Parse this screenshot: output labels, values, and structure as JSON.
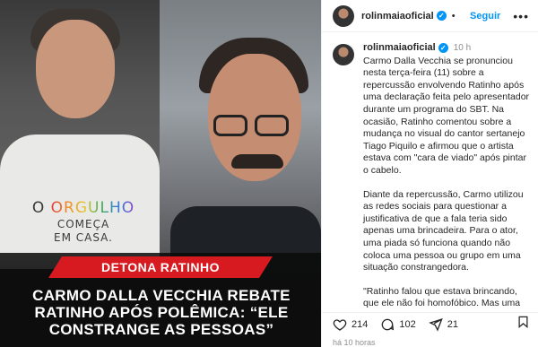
{
  "post": {
    "author": "rolinmaiaoficial",
    "follow_label": "Seguir",
    "more_label": "•••",
    "dot": "•",
    "verified_mark": "✓",
    "time_ago": "10 h",
    "caption_paragraphs": [
      "Carmo Dalla Vecchia se pronunciou nesta terça-feira (11) sobre a repercussão envolvendo Ratinho após uma declaração feita pelo apresentador durante um programa do SBT. Na ocasião, Ratinho comentou sobre a mudança no visual do cantor sertanejo Tiago Piquilo e afirmou que o artista estava com \"cara de viado\" após pintar o cabelo.",
      "Diante da repercussão, Carmo utilizou as redes sociais para questionar a justificativa de que a fala teria sido apenas uma brincadeira. Para o ator, uma piada só funciona quando não coloca uma pessoa ou grupo em uma situação constrangedora.",
      "\"Ratinho falou que estava brincando, que ele não foi homofóbico. Mas uma"
    ],
    "likes": "214",
    "comments": "102",
    "shares": "21",
    "posted_ago": "há 10 horas"
  },
  "image": {
    "shirt_line1_a": "O ",
    "shirt_line1_b": "ORGULHO",
    "shirt_line2": "COMEÇA",
    "shirt_line3": "EM CASA.",
    "banner": "DETONA RATINHO",
    "headline": "CARMO DALLA VECCHIA REBATE RATINHO APÓS POLÊMICA: “ELE CONSTRANGE AS PESSOAS”"
  },
  "colors": {
    "accent": "#0095f6",
    "banner_red": "#d71920"
  },
  "icons": {
    "like": "heart-icon",
    "comment": "comment-icon",
    "share": "share-icon",
    "save": "bookmark-icon",
    "verified": "verified-badge-icon",
    "more": "more-options-icon"
  }
}
